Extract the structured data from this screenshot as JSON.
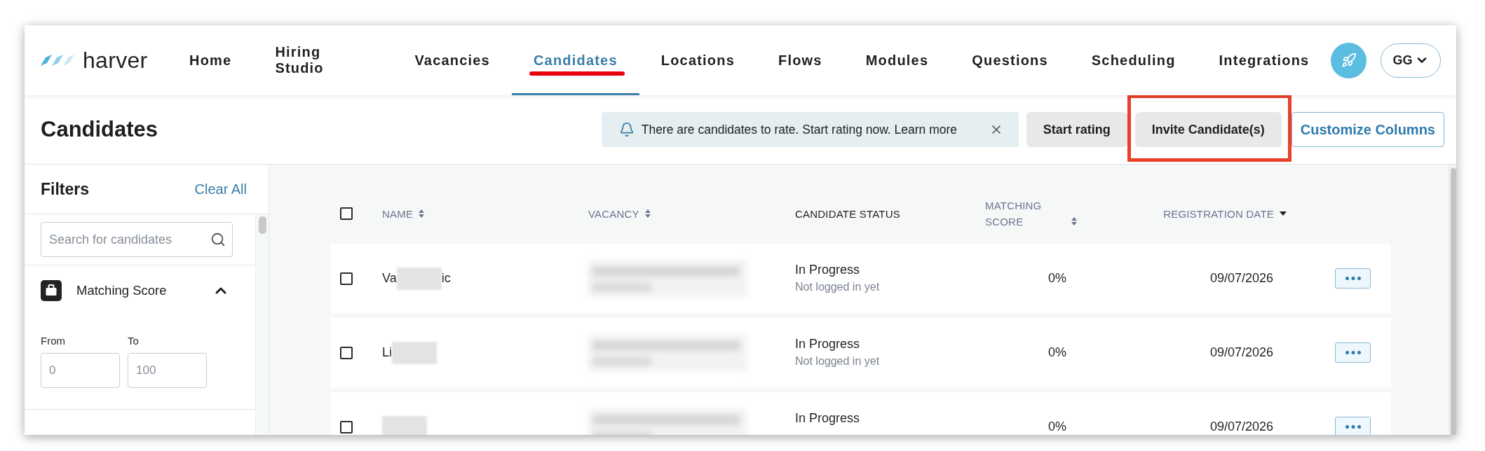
{
  "nav": {
    "brand": "harver",
    "tabs": [
      {
        "label": "Home",
        "selected": false,
        "highlighted": false
      },
      {
        "label": "Hiring Studio",
        "selected": false,
        "highlighted": false
      },
      {
        "label": "Vacancies",
        "selected": false,
        "highlighted": false
      },
      {
        "label": "Candidates",
        "selected": true,
        "highlighted": true
      },
      {
        "label": "Locations",
        "selected": false,
        "highlighted": false
      },
      {
        "label": "Flows",
        "selected": false,
        "highlighted": false
      },
      {
        "label": "Modules",
        "selected": false,
        "highlighted": false
      },
      {
        "label": "Questions",
        "selected": false,
        "highlighted": false
      },
      {
        "label": "Scheduling",
        "selected": false,
        "highlighted": false
      },
      {
        "label": "Integrations",
        "selected": false,
        "highlighted": false
      }
    ],
    "account": {
      "initials": "GG"
    }
  },
  "header": {
    "title": "Candidates",
    "notice": {
      "text": "There are candidates to rate. Start rating now. Learn more"
    },
    "buttons": [
      {
        "label": "Start rating",
        "kind": "filled",
        "highlighted": false
      },
      {
        "label": "Invite Candidate(s)",
        "kind": "filled",
        "highlighted": true
      },
      {
        "label": "Customize Columns",
        "kind": "outline",
        "highlighted": false
      }
    ]
  },
  "filters": {
    "title": "Filters",
    "clear": "Clear All",
    "search": {
      "placeholder": "Search for candidates"
    },
    "sections": [
      {
        "label": "Matching Score",
        "expanded": true,
        "from": {
          "label": "From",
          "placeholder": "0"
        },
        "to": {
          "label": "To",
          "placeholder": "100"
        }
      }
    ]
  },
  "table": {
    "all_checked": false,
    "columns": [
      {
        "label": "NAME",
        "sortable": true,
        "sorted": false
      },
      {
        "label": "VACANCY",
        "sortable": true,
        "sorted": false
      },
      {
        "label": "CANDIDATE STATUS",
        "sortable": false
      },
      {
        "label": "MATCHING SCORE",
        "sortable": true,
        "sorted": false
      },
      {
        "label": "REGISTRATION DATE",
        "sortable": true,
        "sorted": true
      }
    ],
    "rows": [
      {
        "checked": false,
        "name": [
          {
            "kind": "text",
            "text": "Va"
          },
          {
            "kind": "redacted"
          },
          {
            "kind": "text",
            "text": "ic"
          }
        ],
        "vacancy": {
          "redacted": true
        },
        "status": "In Progress",
        "status_detail": "Not logged in yet",
        "score": "0%",
        "registered": "09/07/2026"
      },
      {
        "checked": false,
        "name": [
          {
            "kind": "text",
            "text": "Li"
          },
          {
            "kind": "redacted"
          }
        ],
        "vacancy": {
          "redacted": true
        },
        "status": "In Progress",
        "status_detail": "Not logged in yet",
        "score": "0%",
        "registered": "09/07/2026"
      },
      {
        "checked": false,
        "name": [
          {
            "kind": "redacted"
          }
        ],
        "vacancy": {
          "redacted": true
        },
        "status": "In Progress",
        "score": "0%",
        "registered": "09/07/2026"
      }
    ]
  }
}
